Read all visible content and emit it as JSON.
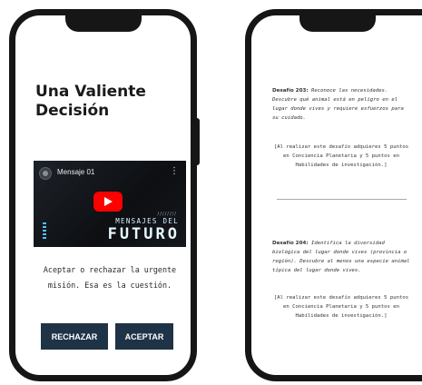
{
  "left_screen": {
    "title": "Una Valiente Decisión",
    "video": {
      "channel_title": "Mensaje 01",
      "menu": "⋮",
      "brand_line1": "MENSAJES DEL",
      "brand_line2": "FUTURO",
      "play_color": "#ff0000"
    },
    "body_text": "Aceptar o rechazar la urgente misión. Esa es la cuestión.",
    "buttons": {
      "reject": "RECHAZAR",
      "accept": "ACEPTAR"
    },
    "button_color": "#1f3347"
  },
  "right_screen": {
    "challenges": [
      {
        "label": "Desafío 203:",
        "text": "Reconoce las necesidades. Descubre qué animal está en peligro en el lugar donde vives y requiere esfuerzos para su cuidado.",
        "reward": "[Al realizar este desafío adquieres 5 puntos en Conciencia Planetaria y 5 puntos en Habilidades de investigación.]"
      },
      {
        "label": "Desafío 204:",
        "text": "Identifica la diversidad biológica del lugar donde vives (provincia o región). Descubre al menos una especie animal típica del lugar donde vives.",
        "reward": "[Al realizar este desafío adquieres 5 puntos en Conciencia Planetaria y 5 puntos en Habilidades de investigación.]"
      }
    ]
  }
}
